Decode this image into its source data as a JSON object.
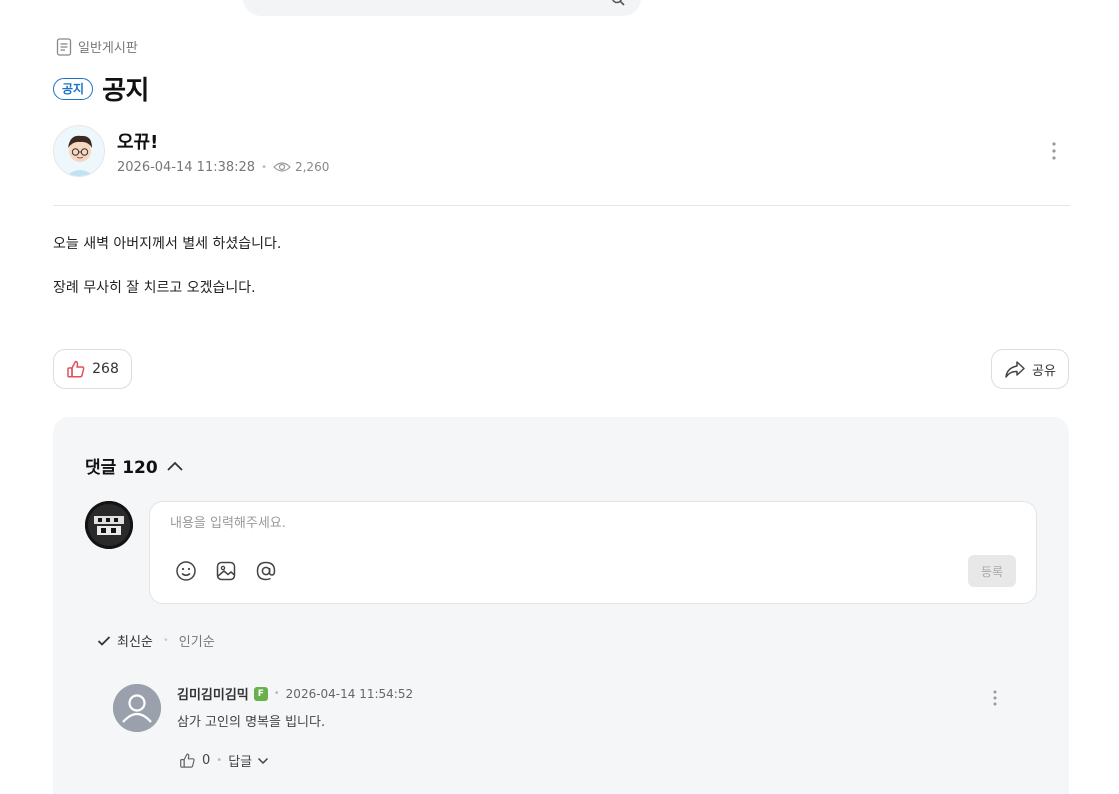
{
  "board": {
    "icon": "document-icon",
    "name": "일반게시판"
  },
  "post": {
    "badge": "공지",
    "title": "공지",
    "author": "오뀨!",
    "date": "2026-04-14 11:38:28",
    "views": "2,260",
    "body": [
      "오늘 새벽 아버지께서 별세 하셨습니다.",
      "장례 무사히 잘 치르고 오겠습니다."
    ],
    "likes": "268",
    "share_label": "공유"
  },
  "comments": {
    "label": "댓글",
    "count": "120",
    "input_placeholder": "내용을 입력해주세요.",
    "submit_label": "등록",
    "sort": {
      "latest": "최신순",
      "popular": "인기순"
    },
    "items": [
      {
        "author": "김미김미김믹",
        "grade": "F",
        "date": "2026-04-14 11:54:52",
        "text": "삼가 고인의 명복을 빕니다.",
        "likes": "0",
        "reply_label": "답글"
      }
    ]
  },
  "colors": {
    "accent": "#1a73c9",
    "panel": "#f5f6f8",
    "like": "#e0505a",
    "grade": "#6ab04c"
  }
}
